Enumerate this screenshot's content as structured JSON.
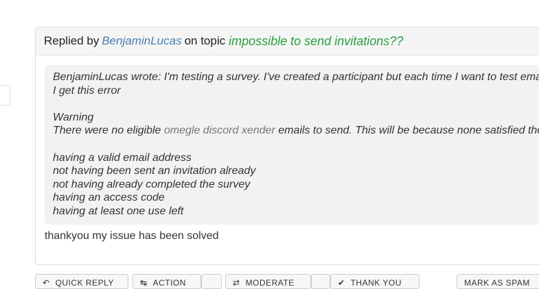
{
  "post": {
    "replied_by": "Replied by",
    "author": "BenjaminLucas",
    "on_topic": "on topic",
    "topic": "impossible to send invitations??",
    "quote": {
      "intro_line1": "BenjaminLucas wrote: I'm testing a survey. I've created a participant but each time I want to test email",
      "intro_line2": "I get this error",
      "warning": "Warning",
      "error_prefix": "There were no eligible",
      "error_spam": "omegle discord xender",
      "error_suffix": "emails to send. This will be because none satisfied the",
      "criteria": [
        "having a valid email address",
        "not having been sent an invitation already",
        "not having already completed the survey",
        "having an access code",
        "having at least one use left"
      ]
    },
    "reply": "thankyou my issue has been solved"
  },
  "actions": {
    "quick_reply": "QUICK REPLY",
    "action": "ACTION",
    "moderate": "MODERATE",
    "thank_you": "THANK YOU",
    "mark_as_spam": "MARK AS SPAM"
  },
  "colors": {
    "author_link": "#4a7fb0",
    "topic_link": "#2a9d3f"
  }
}
